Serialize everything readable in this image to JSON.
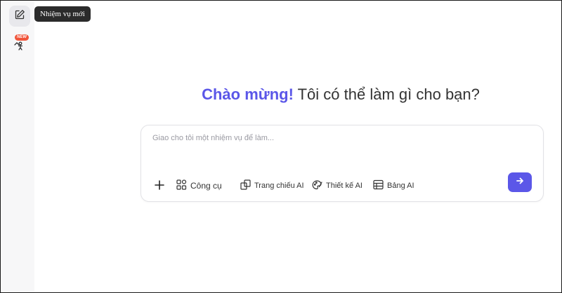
{
  "sidebar": {
    "tooltip": "Nhiệm vụ mới",
    "new_badge": "NEW",
    "icons": [
      "edit-icon",
      "agent-icon"
    ]
  },
  "greeting": {
    "highlight": "Chào mừng!",
    "rest": " Tôi có thể làm gì cho bạn?"
  },
  "composer": {
    "placeholder": "Giao cho tôi một nhiệm vụ để làm...",
    "tools": [
      {
        "label": "Công cụ",
        "icon": "tools-icon"
      },
      {
        "label": "Trang chiếu AI",
        "icon": "slides-icon"
      },
      {
        "label": "Thiết kế AI",
        "icon": "palette-icon"
      },
      {
        "label": "Bảng AI",
        "icon": "table-icon"
      }
    ],
    "send_icon": "arrow-right-icon"
  },
  "colors": {
    "accent": "#5b57e8",
    "badge": "#f0543a",
    "tooltip_bg": "#2b2b2b"
  }
}
